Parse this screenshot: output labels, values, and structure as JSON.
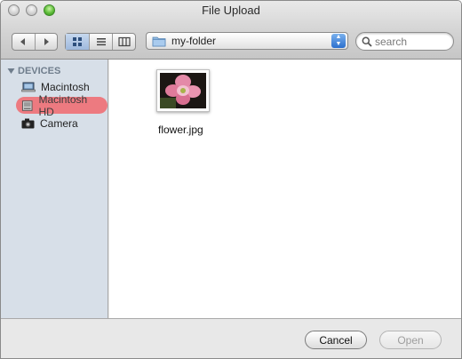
{
  "window": {
    "title": "File Upload"
  },
  "toolbar": {
    "nav_icons": [
      "back-arrow-icon",
      "forward-arrow-icon"
    ],
    "view_modes": [
      "icon-view",
      "list-view",
      "column-view"
    ],
    "active_view": "icon-view",
    "location": "my-folder",
    "search_placeholder": "search"
  },
  "sidebar": {
    "section_title": "DEVICES",
    "items": [
      {
        "label": "Macintosh",
        "icon": "laptop-icon",
        "selected": false
      },
      {
        "label": "Macintosh HD",
        "icon": "hard-drive-icon",
        "selected": true
      },
      {
        "label": "Camera",
        "icon": "camera-icon",
        "selected": false
      }
    ]
  },
  "files": [
    {
      "name": "flower.jpg",
      "icon": "image-thumbnail"
    }
  ],
  "buttons": {
    "cancel": "Cancel",
    "open": "Open"
  },
  "colors": {
    "selection": "#ed7a80",
    "sidebar_bg": "#d7dfe8",
    "active_view": "#a9c2e3"
  }
}
